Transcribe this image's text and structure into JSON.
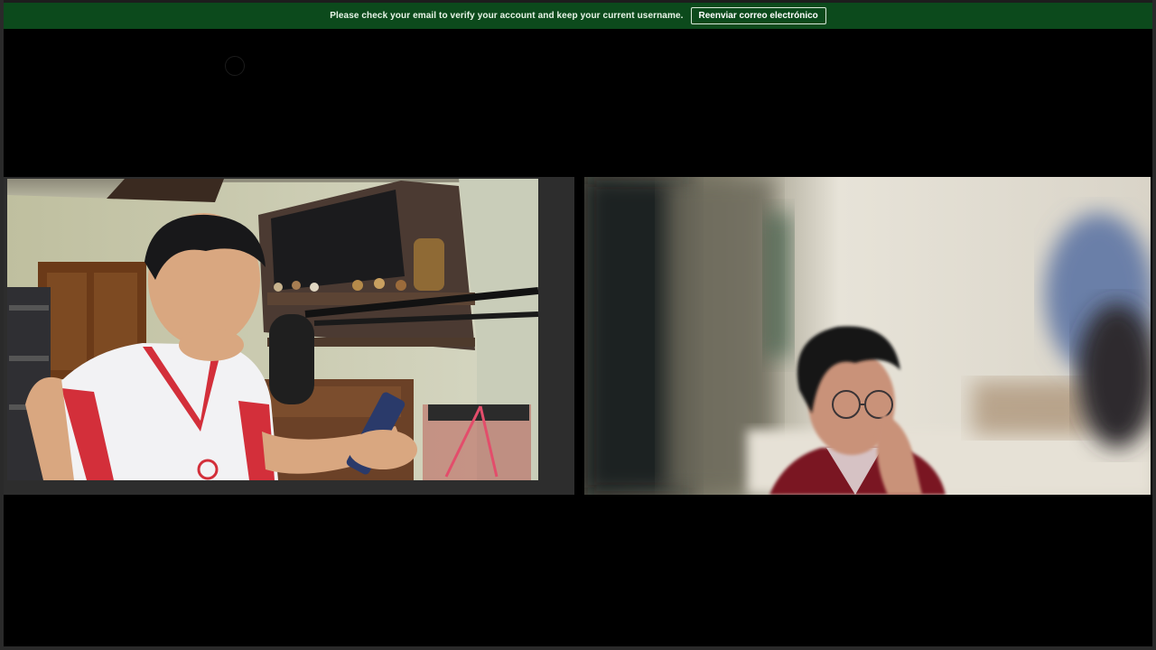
{
  "banner": {
    "message": "Please check your email to verify your account and keep your current username.",
    "resend_label": "Reenviar correo electrónico"
  },
  "call": {
    "participants": [
      {
        "tile": "participant-tile-1"
      },
      {
        "tile": "participant-tile-2"
      }
    ]
  },
  "colors": {
    "banner_bg": "#0c4a1c",
    "stage_bg": "#000000"
  },
  "icons": {
    "loading": "loading-spinner-icon"
  }
}
